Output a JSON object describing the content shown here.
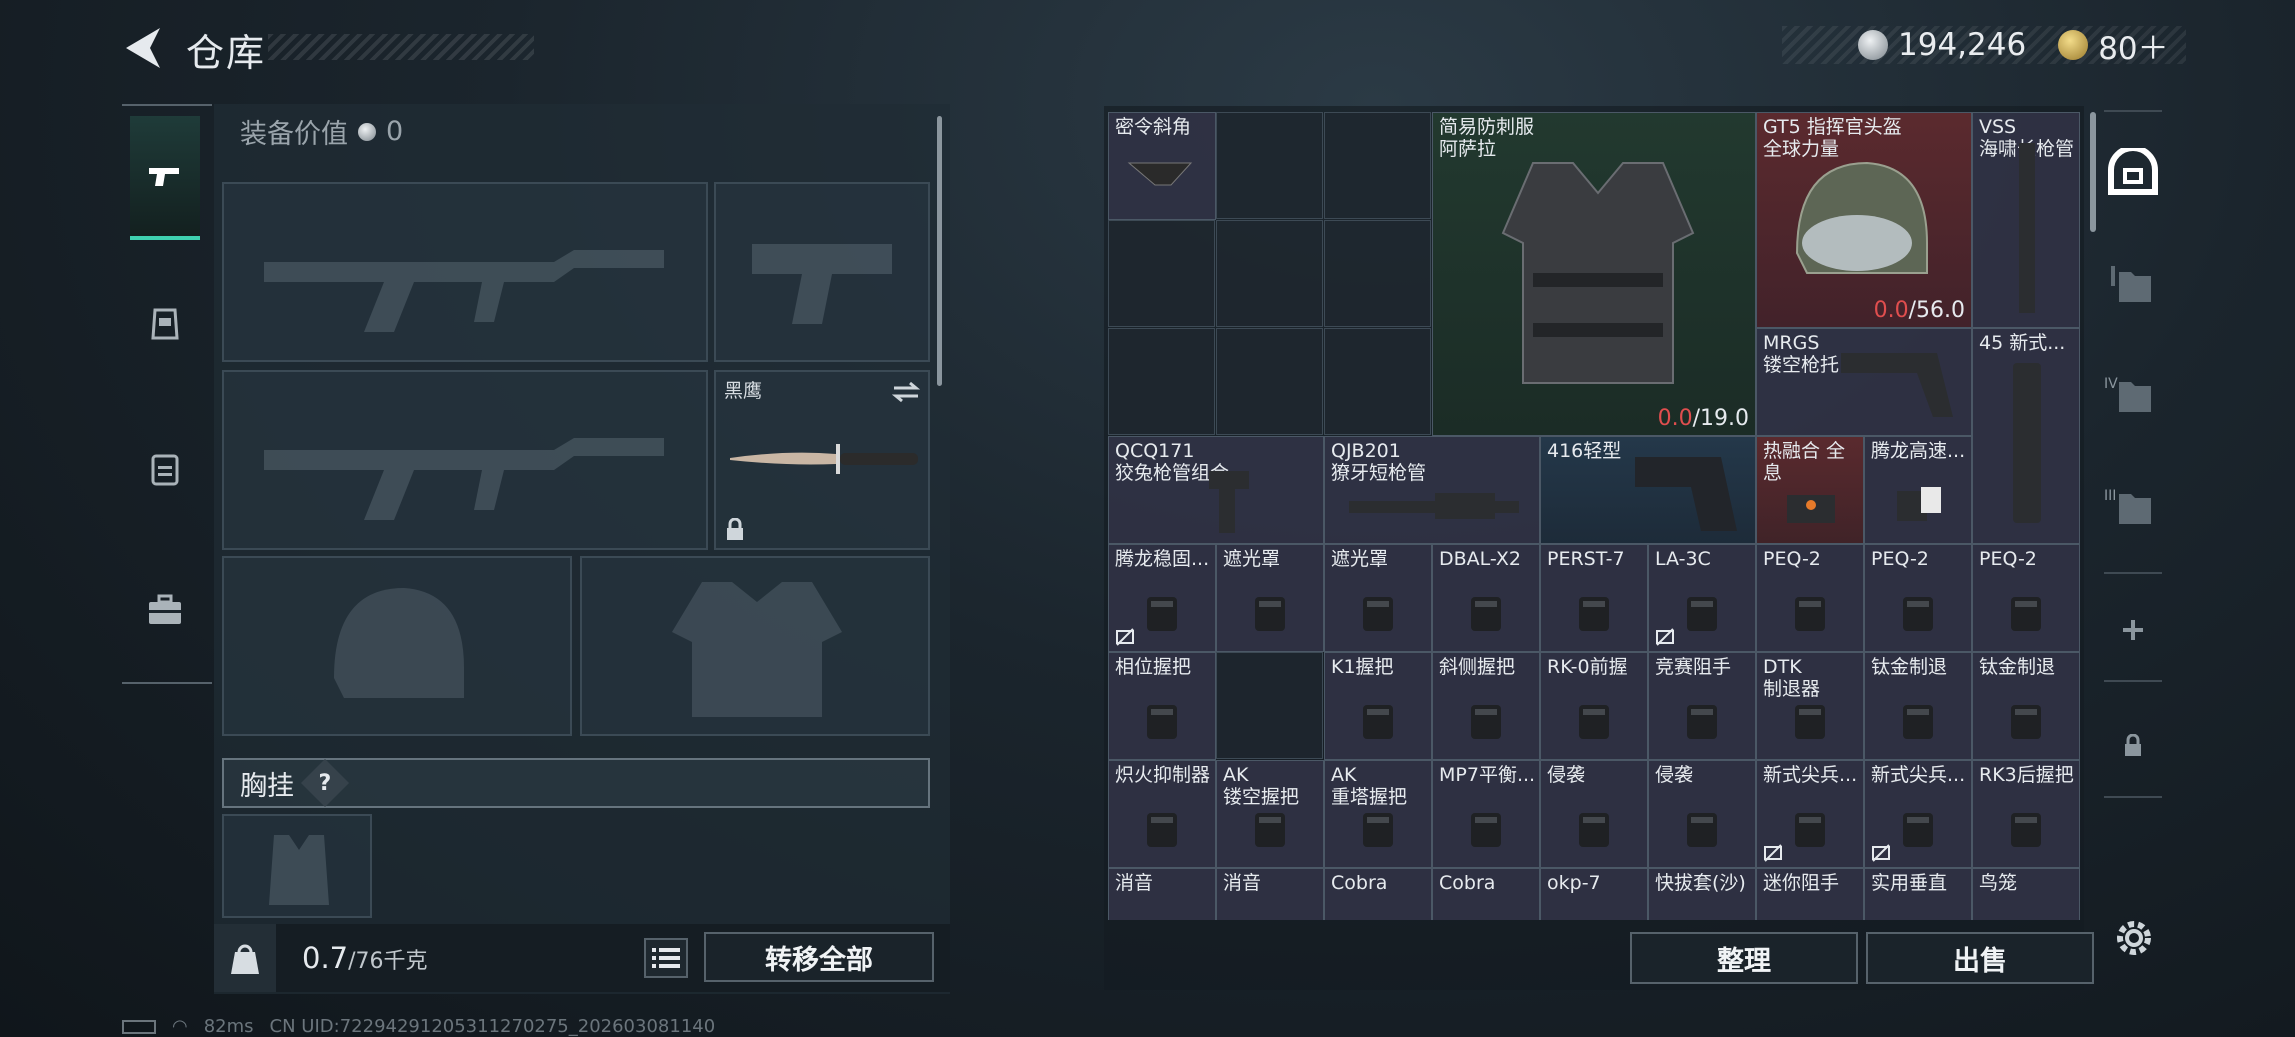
{
  "header": {
    "title": "仓库"
  },
  "currency": {
    "silver": "194,246",
    "gold": "80＋"
  },
  "equipment": {
    "value_label": "装备价值",
    "value": "0",
    "melee_name": "黑鹰",
    "chest_label": "胸挂",
    "chest_help": "?"
  },
  "footer": {
    "weight_current": "0.7",
    "weight_max": "/76千克",
    "transfer_all": "转移全部",
    "sort": "整理",
    "sell": "出售"
  },
  "status_bar": {
    "ping": "82ms",
    "uid": "CN UID:7229429120531127027​5_202603081140"
  },
  "storage_items": {
    "i01": "密令斜角",
    "i02": "简易防刺服\n阿萨拉",
    "i02_dur_cur": "0.0",
    "i02_dur_max": "/19.0",
    "i03": "GT5 指挥官头盔\n全球力量",
    "i03_dur_cur": "0.0",
    "i03_dur_max": "/56.0",
    "i04": "VSS\n海啸长枪管",
    "i05": "MRGS\n镂空枪托",
    "i06": "45 新式...",
    "i07": "QCQ171\n狡兔枪管组合",
    "i08": "QJB201\n獠牙短枪管",
    "i09": "416轻型",
    "i10": "热融合 全息",
    "i11": "腾龙高速...",
    "i12": "腾龙稳固...",
    "i13": "遮光罩",
    "i14": "遮光罩",
    "i15": "DBAL-X2",
    "i16": "PERST-7",
    "i17": "LA-3C",
    "i18": "PEQ-2",
    "i19": "PEQ-2",
    "i20": "PEQ-2",
    "i21": "相位握把",
    "i22": "K1握把",
    "i23": "斜侧握把",
    "i24": "RK-0前握",
    "i25": "竞赛阻手",
    "i26": "DTK\n制退器",
    "i27": "钛金制退",
    "i28": "钛金制退",
    "i29": "炽火抑制器",
    "i30": "AK\n镂空握把",
    "i31": "AK\n重塔握把",
    "i32": "MP7平衡...",
    "i33": "侵袭",
    "i34": "侵袭",
    "i35": "新式尖兵...",
    "i36": "新式尖兵...",
    "i37": "RK3后握把",
    "i38": "消音",
    "i39": "消音",
    "i40": "Cobra",
    "i41": "Cobra",
    "i42": "okp-7",
    "i43": "快拔套(沙)",
    "i44": "迷你阻手",
    "i45": "实用垂直",
    "i46": "鸟笼"
  },
  "right_rail": {
    "tab3": "III",
    "tab4": "IV"
  },
  "colors": {
    "accent": "#3fd1b0",
    "durability_low": "#e04e4e"
  }
}
